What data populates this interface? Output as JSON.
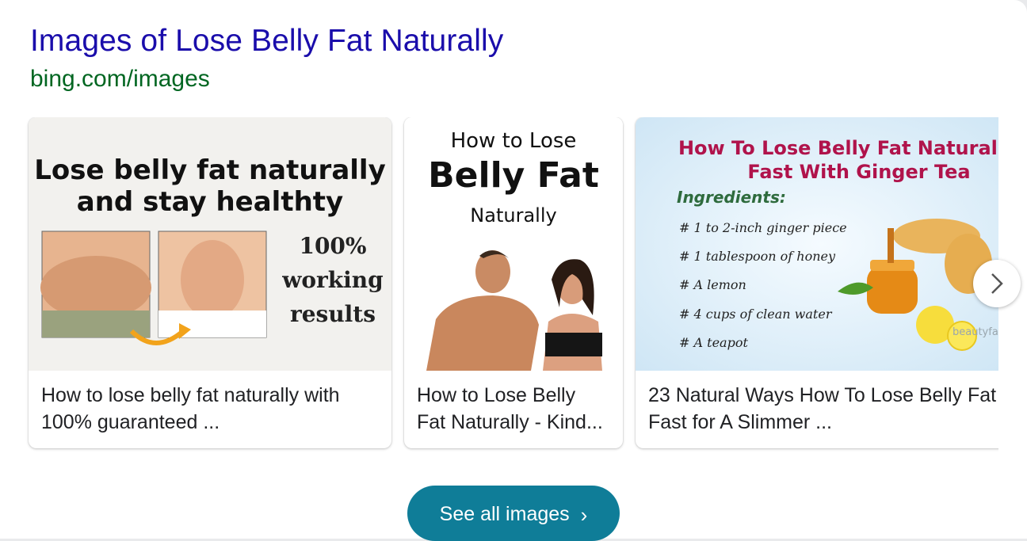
{
  "header": {
    "title": "Images of Lose Belly Fat Naturally",
    "source": "bing.com/images"
  },
  "cards": [
    {
      "caption_line1": "How to lose belly fat naturally with",
      "caption_line2": "100% guaranteed ...",
      "image_text": {
        "line1": "Lose belly fat naturally",
        "line2": "and stay healthty",
        "badge1": "100%",
        "badge2": "working",
        "badge3": "results"
      }
    },
    {
      "caption_line1": "How to Lose Belly",
      "caption_line2": "Fat Naturally - Kind...",
      "image_text": {
        "line1": "How to Lose",
        "line2": "Belly Fat",
        "line3": "Naturally"
      }
    },
    {
      "caption_line1": "23 Natural Ways How To Lose Belly Fat",
      "caption_line2": "Fast for A Slimmer ...",
      "image_text": {
        "line1": "How To Lose Belly Fat Naturally &",
        "line2": "Fast With Ginger Tea",
        "heading": "Ingredients:",
        "items": [
          "# 1 to 2-inch ginger piece",
          "# 1 tablespoon of honey",
          "# A lemon",
          "# 4 cups of clean water",
          "# A teapot"
        ],
        "watermark": "beautyfalk.com"
      }
    }
  ],
  "see_all": {
    "label": "See all images",
    "icon": "chevron-right-icon"
  },
  "next_button": {
    "icon": "chevron-right-icon"
  },
  "colors": {
    "title_link": "#1a0dab",
    "source": "#006621",
    "button": "#0f7d98",
    "tea_title": "#b0134b"
  }
}
